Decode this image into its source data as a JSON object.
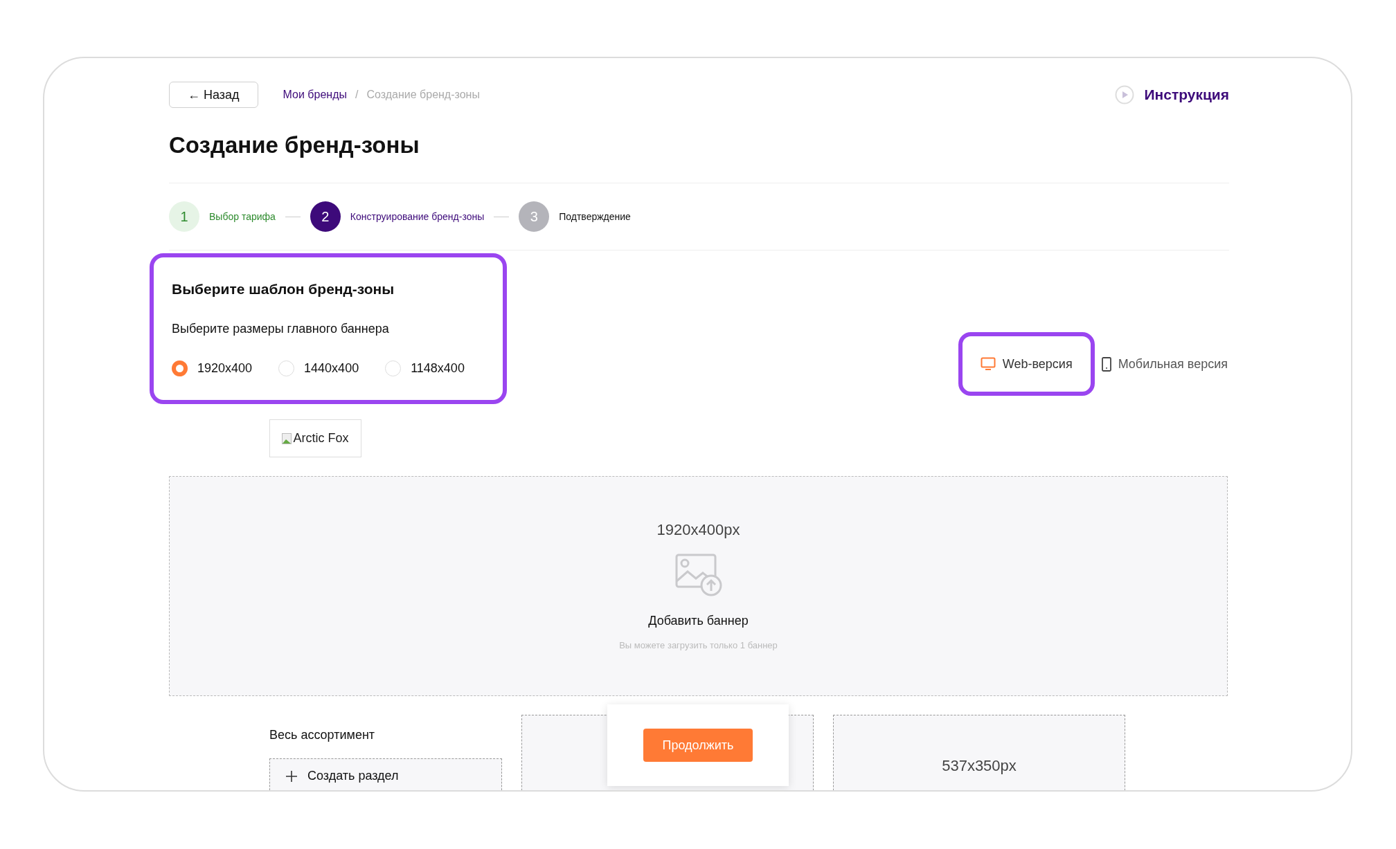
{
  "back_button": {
    "label": "← Назад"
  },
  "breadcrumbs": [
    {
      "label": "Мои бренды",
      "current": false
    },
    {
      "label": "Создание бренд-зоны",
      "current": true
    }
  ],
  "breadcrumb_separator": "/",
  "instruction_link": {
    "label": "Инструкция"
  },
  "title": "Создание бренд-зоны",
  "steps": [
    {
      "number": "1",
      "label": "Выбор тарифа",
      "completed": true,
      "selected": false
    },
    {
      "number": "2",
      "label": "Конструирование бренд-зоны",
      "completed": false,
      "selected": true
    },
    {
      "number": "3",
      "label": "Подтверждение",
      "completed": false,
      "selected": false
    }
  ],
  "template_panel": {
    "title": "Выберите шаблон бренд-зоны",
    "subtitle": "Выберите размеры главного баннера",
    "highlighted": true,
    "options": [
      {
        "label": "1920x400",
        "selected": true
      },
      {
        "label": "1440x400",
        "selected": false
      },
      {
        "label": "1148x400",
        "selected": false
      }
    ]
  },
  "view_toggle": [
    {
      "label": "Web-версия",
      "kind": "web",
      "selected": true,
      "highlighted": true
    },
    {
      "label": "Мобильная версия",
      "kind": "mobile",
      "selected": false,
      "highlighted": false
    }
  ],
  "broken_image": {
    "alt": "Arctic Fox"
  },
  "banner_upload": {
    "size": "1920x400px",
    "label": "Добавить баннер",
    "hint": "Вы можете загрузить только 1 баннер"
  },
  "assortment": {
    "title": "Весь ассортимент",
    "create_button": "Создать раздел"
  },
  "small_banner": {
    "size": "537x350px"
  },
  "continue_button": {
    "label": "Продолжить"
  }
}
